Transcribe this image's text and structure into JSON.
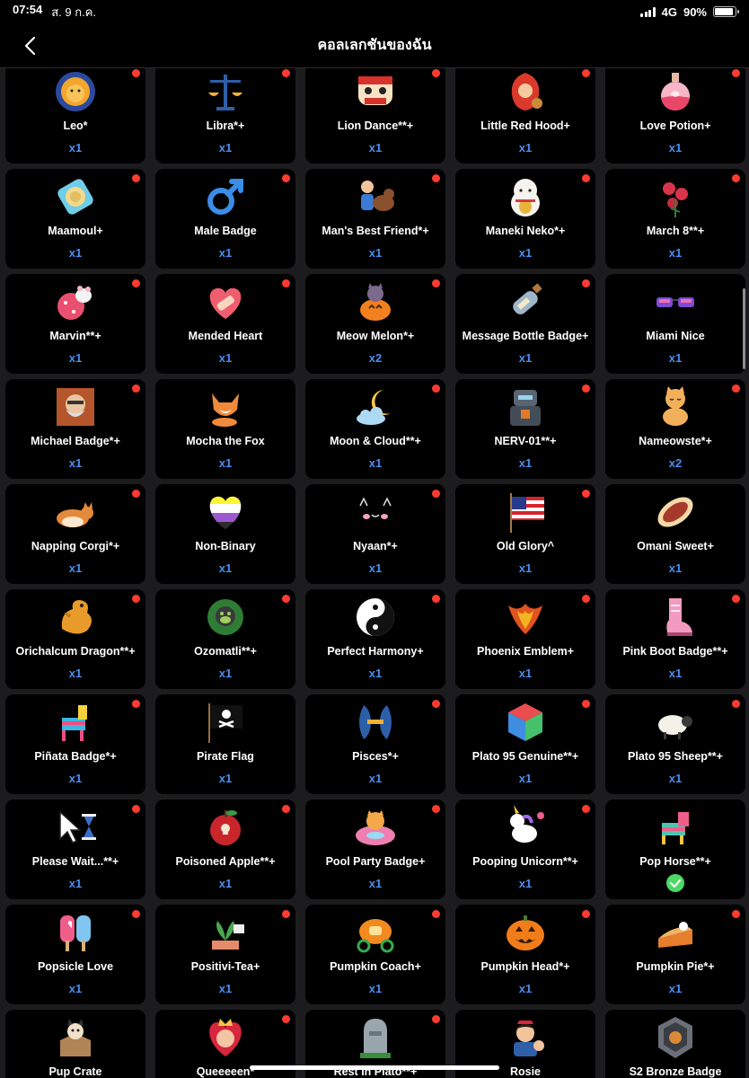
{
  "status_bar": {
    "time": "07:54",
    "date": "ส. 9 ก.ค.",
    "network": "4G",
    "battery": "90%",
    "battery_level": 0.9
  },
  "nav": {
    "title": "คอลเลกชันของฉัน"
  },
  "badges": [
    {
      "name": "Leo*",
      "count": "x1",
      "icon": "lion-icon"
    },
    {
      "name": "Libra*+",
      "count": "x1",
      "icon": "scales-icon"
    },
    {
      "name": "Lion Dance**+",
      "count": "x1",
      "icon": "lion-dance-icon"
    },
    {
      "name": "Little Red Hood+",
      "count": "x1",
      "icon": "red-hood-icon"
    },
    {
      "name": "Love Potion+",
      "count": "x1",
      "icon": "potion-icon"
    },
    {
      "name": "Maamoul+",
      "count": "x1",
      "icon": "maamoul-icon"
    },
    {
      "name": "Male Badge",
      "count": "x1",
      "icon": "male-symbol-icon"
    },
    {
      "name": "Man's Best Friend*+",
      "count": "x1",
      "icon": "dog-friend-icon"
    },
    {
      "name": "Maneki Neko*+",
      "count": "x1",
      "icon": "lucky-cat-icon"
    },
    {
      "name": "March 8**+",
      "count": "x1",
      "icon": "flowers-icon"
    },
    {
      "name": "Marvin**+",
      "count": "x1",
      "icon": "marvin-icon"
    },
    {
      "name": "Mended Heart",
      "count": "x1",
      "icon": "mended-heart-icon"
    },
    {
      "name": "Meow Melon*+",
      "count": "x2",
      "icon": "cat-pumpkin-icon"
    },
    {
      "name": "Message Bottle Badge+",
      "count": "x1",
      "icon": "message-bottle-icon"
    },
    {
      "name": "Miami Nice",
      "count": "x1",
      "icon": "sunglasses-icon"
    },
    {
      "name": "Michael Badge*+",
      "count": "x1",
      "icon": "michael-portrait-icon"
    },
    {
      "name": "Mocha the Fox",
      "count": "x1",
      "icon": "fox-icon"
    },
    {
      "name": "Moon & Cloud**+",
      "count": "x1",
      "icon": "moon-cloud-icon"
    },
    {
      "name": "NERV-01**+",
      "count": "x1",
      "icon": "robot-icon"
    },
    {
      "name": "Nameowste*+",
      "count": "x2",
      "icon": "meditating-cat-icon"
    },
    {
      "name": "Napping Corgi*+",
      "count": "x1",
      "icon": "corgi-icon"
    },
    {
      "name": "Non-Binary",
      "count": "x1",
      "icon": "nonbinary-heart-icon"
    },
    {
      "name": "Nyaan*+",
      "count": "x1",
      "icon": "cat-face-icon"
    },
    {
      "name": "Old Glory^",
      "count": "x1",
      "icon": "us-flag-icon"
    },
    {
      "name": "Omani Sweet+",
      "count": "x1",
      "icon": "omani-sweet-icon"
    },
    {
      "name": "Orichalcum Dragon**+",
      "count": "x1",
      "icon": "dragon-icon"
    },
    {
      "name": "Ozomatli**+",
      "count": "x1",
      "icon": "monkey-icon"
    },
    {
      "name": "Perfect Harmony+",
      "count": "x1",
      "icon": "yin-yang-cat-icon"
    },
    {
      "name": "Phoenix Emblem+",
      "count": "x1",
      "icon": "phoenix-icon"
    },
    {
      "name": "Pink Boot Badge**+",
      "count": "x1",
      "icon": "pink-boot-icon"
    },
    {
      "name": "Piñata Badge*+",
      "count": "x1",
      "icon": "pinata-icon"
    },
    {
      "name": "Pirate Flag",
      "count": "x1",
      "icon": "pirate-flag-icon"
    },
    {
      "name": "Pisces*+",
      "count": "x1",
      "icon": "pisces-icon"
    },
    {
      "name": "Plato 95 Genuine**+",
      "count": "x1",
      "icon": "cube-icon"
    },
    {
      "name": "Plato 95 Sheep**+",
      "count": "x1",
      "icon": "sheep-icon"
    },
    {
      "name": "Please Wait...**+",
      "count": "x1",
      "icon": "cursor-hourglass-icon"
    },
    {
      "name": "Poisoned Apple**+",
      "count": "x1",
      "icon": "poison-apple-icon"
    },
    {
      "name": "Pool Party Badge+",
      "count": "x1",
      "icon": "pool-float-icon"
    },
    {
      "name": "Pooping Unicorn**+",
      "count": "x1",
      "icon": "unicorn-icon"
    },
    {
      "name": "Pop Horse**+",
      "count": "",
      "icon": "pop-horse-icon",
      "owned_check": true
    },
    {
      "name": "Popsicle Love",
      "count": "x1",
      "icon": "popsicle-icon"
    },
    {
      "name": "Positivi-Tea+",
      "count": "x1",
      "icon": "tea-plant-icon"
    },
    {
      "name": "Pumpkin Coach+",
      "count": "x1",
      "icon": "pumpkin-coach-icon"
    },
    {
      "name": "Pumpkin Head*+",
      "count": "x1",
      "icon": "jack-o-lantern-icon"
    },
    {
      "name": "Pumpkin Pie*+",
      "count": "x1",
      "icon": "pie-icon"
    },
    {
      "name": "Pup Crate",
      "count": "",
      "icon": "pup-crate-icon"
    },
    {
      "name": "Queeeeen*",
      "count": "",
      "icon": "queen-icon"
    },
    {
      "name": "Rest In Plato**+",
      "count": "",
      "icon": "tombstone-icon"
    },
    {
      "name": "Rosie",
      "count": "",
      "icon": "rosie-icon"
    },
    {
      "name": "S2 Bronze Badge",
      "count": "",
      "icon": "bronze-shield-icon"
    }
  ],
  "red_dot_indices": [
    0,
    1,
    2,
    3,
    4,
    5,
    6,
    7,
    8,
    9,
    10,
    11,
    12,
    13,
    15,
    17,
    18,
    19,
    20,
    22,
    23,
    25,
    26,
    27,
    28,
    29,
    30,
    32,
    33,
    34,
    35,
    36,
    37,
    38,
    40,
    41,
    42,
    43,
    44,
    46,
    47
  ],
  "colors": {
    "accent_count": "#4a8ef0",
    "notification_dot": "#ff3b30",
    "card_bg": "#000000",
    "page_bg": "#1c1c1e",
    "owned_check": "#4cd964"
  }
}
